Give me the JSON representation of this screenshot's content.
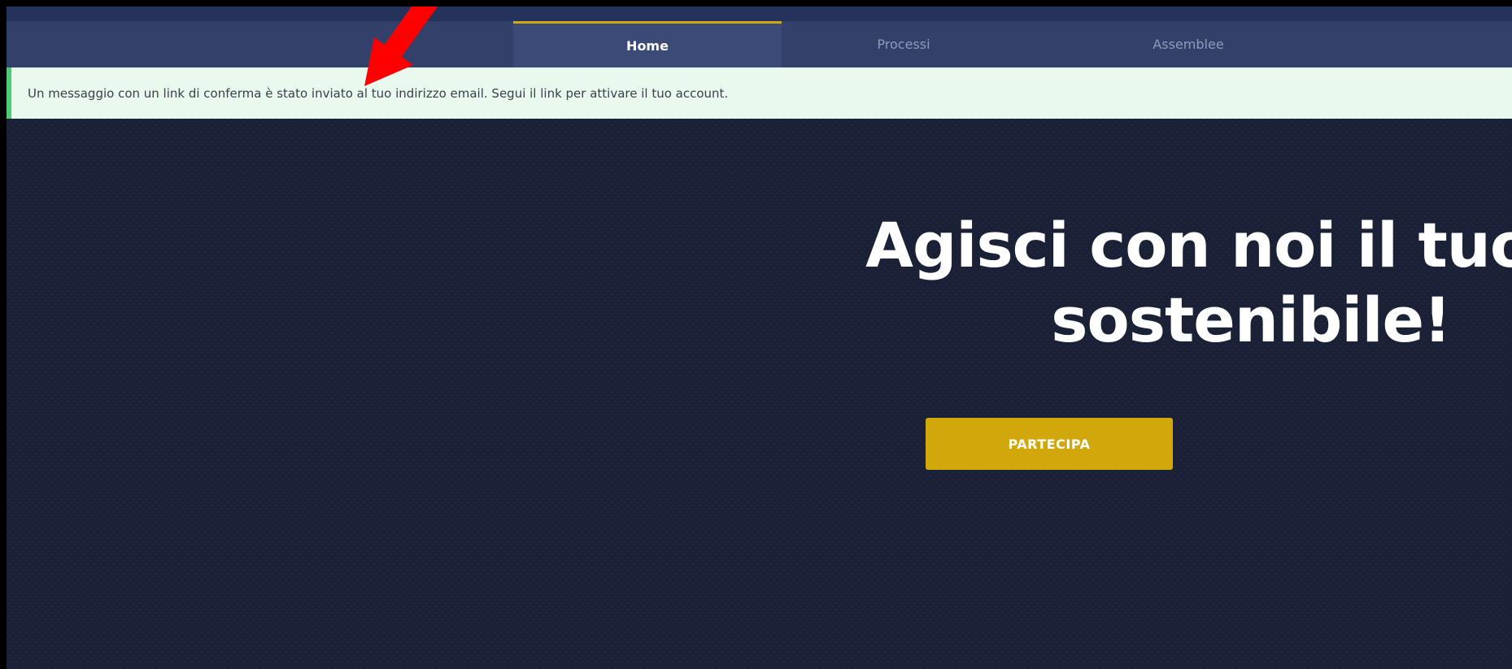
{
  "nav": {
    "items": [
      {
        "label": "Home",
        "active": true
      },
      {
        "label": "Processi",
        "active": false
      },
      {
        "label": "Assemblee",
        "active": false
      }
    ]
  },
  "notice": {
    "message": "Un messaggio con un link di conferma è stato inviato al tuo indirizzo email. Segui il link per attivare il tuo account."
  },
  "hero": {
    "title_line1": "Agisci con noi il tuo im",
    "title_line2": "sostenibile!",
    "cta_label": "PARTECIPA"
  },
  "colors": {
    "nav_bg": "#33416a",
    "accent_gold": "#d2a70c",
    "notice_bg": "#e9f9ee",
    "notice_border": "#4fc972",
    "hero_bg": "#1a2136",
    "arrow_red": "#ff0000"
  },
  "icons": {
    "annotation": "red-arrow-icon"
  }
}
